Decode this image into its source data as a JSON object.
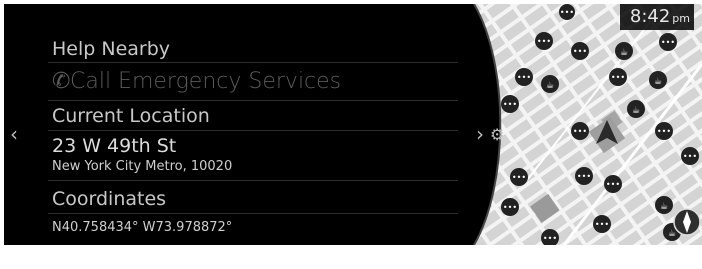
{
  "clock": {
    "time": "8:42",
    "ampm": "pm"
  },
  "help": {
    "title": "Help Nearby",
    "call_label": "Call Emergency Services"
  },
  "location": {
    "title": "Current Location",
    "street": "23 W 49th St",
    "city": "New York City Metro, 10020"
  },
  "coordinates": {
    "title": "Coordinates",
    "value": "N40.758434° W73.978872°"
  },
  "icons": {
    "back": "chevron-left-icon",
    "forward": "chevron-right-icon",
    "settings": "gear-icon",
    "phone": "phone-icon",
    "compass": "compass-icon",
    "position": "navigation-arrow-icon",
    "poi": "poi-marker-icon"
  },
  "colors": {
    "background": "#000000",
    "map_base": "#f2f2f2",
    "map_block": "#cfcfcf",
    "poi": "#222222"
  }
}
